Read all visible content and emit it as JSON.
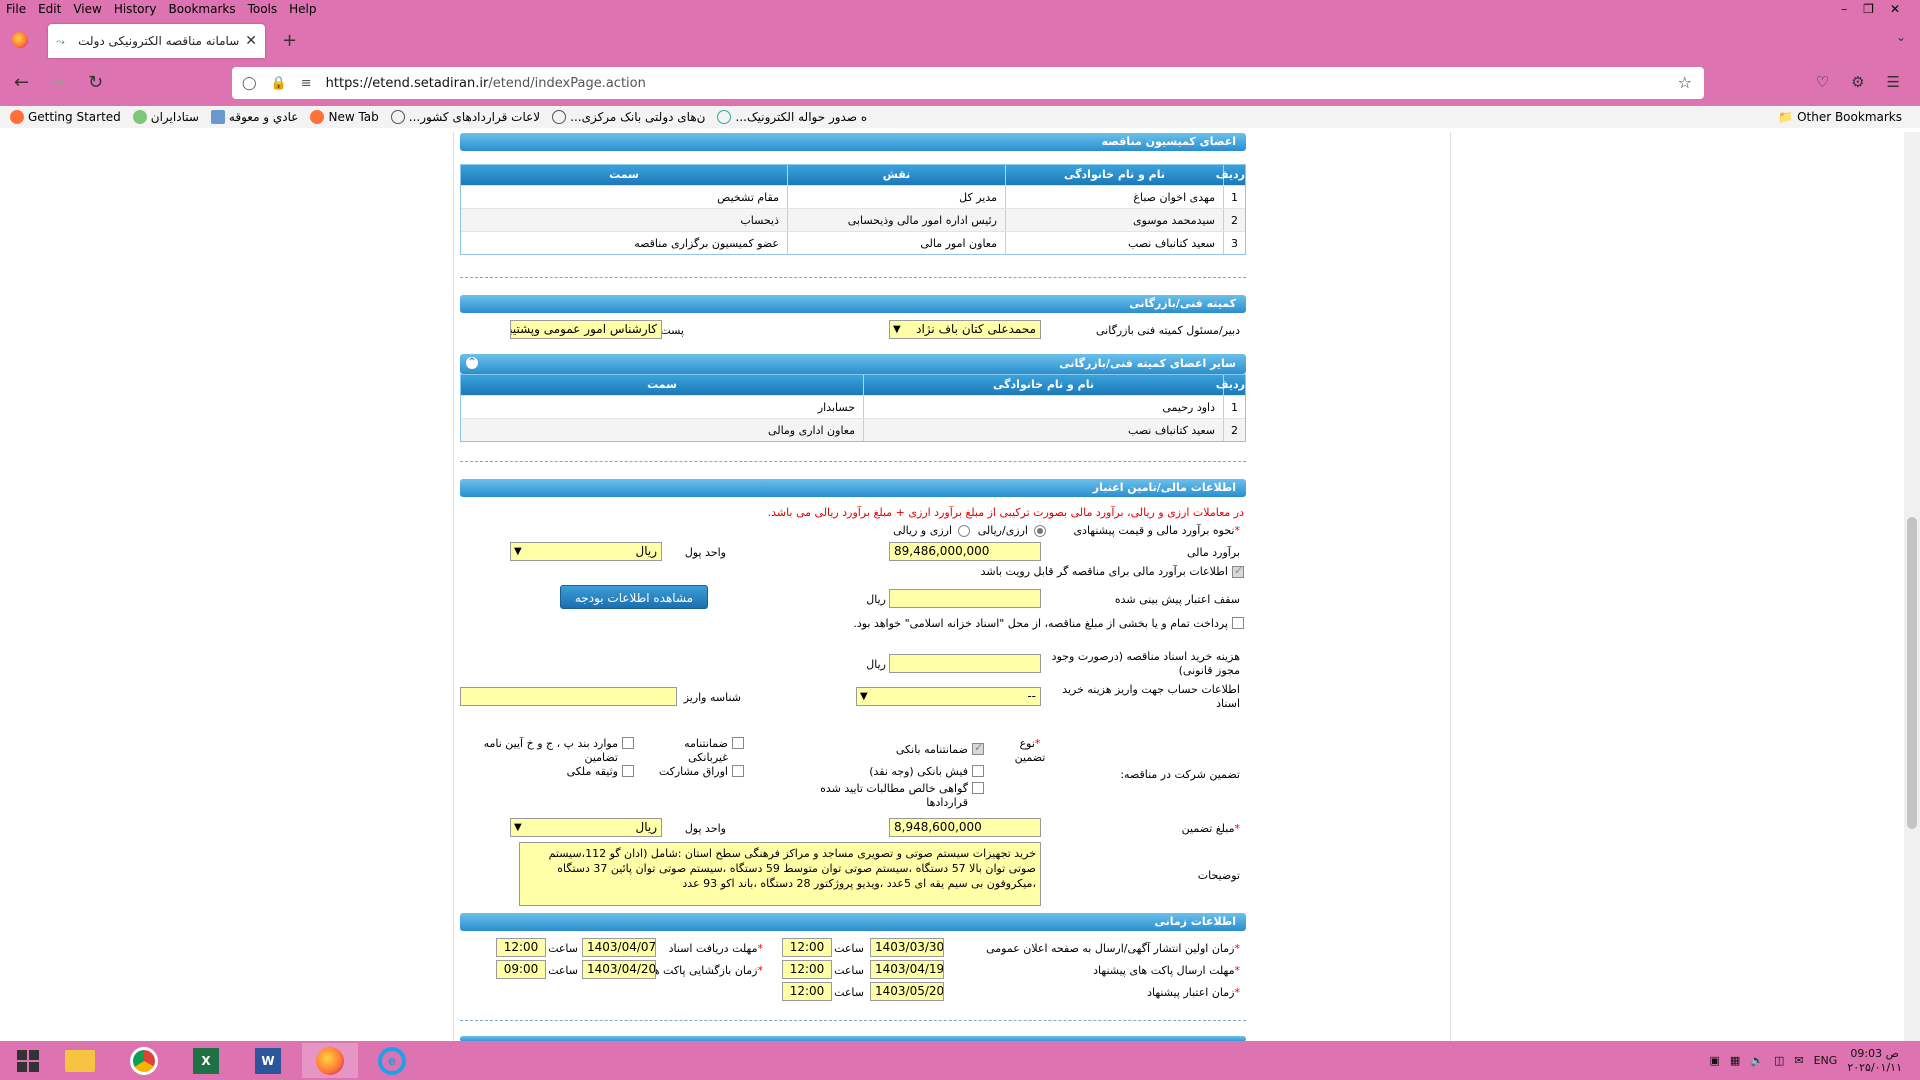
{
  "browser": {
    "menu": [
      "File",
      "Edit",
      "View",
      "History",
      "Bookmarks",
      "Tools",
      "Help"
    ],
    "tab_title": "سامانه مناقصه الکترونیکی دولت",
    "url_host": "https://etend.setadiran.ir",
    "url_path": "/etend/indexPage.action",
    "bookmarks": [
      "Getting Started",
      "ستادایران",
      "عادي و معوقه",
      "New Tab",
      "...لاعات قراردادهای کشور",
      "...ن‌های دولتی بانک مرکزی",
      "...ه صدور حواله الکترونیک"
    ],
    "other_bookmarks": "Other Bookmarks"
  },
  "commission": {
    "header": "اعضای کمیسیون مناقصه",
    "columns": {
      "idx": "ردیف",
      "name": "نام و نام خانوادگی",
      "role": "نقش",
      "position": "سمت"
    },
    "rows": [
      {
        "idx": "1",
        "name": "مهدی اخوان صباغ",
        "role": "مدیر کل",
        "position": "مقام تشخیص"
      },
      {
        "idx": "2",
        "name": "سیدمحمد موسوی",
        "role": "رئیس اداره امور مالی وذیحسابی",
        "position": "ذیحساب"
      },
      {
        "idx": "3",
        "name": "سعید کتانباف نصب",
        "role": "معاون امور مالی",
        "position": "عضو کمیسیون برگزاری مناقصه"
      }
    ]
  },
  "tech": {
    "header": "کمیته فنی/بازرگانی",
    "secretary_label": "دبیر/مسئول کمیته فنی بازرگانی",
    "secretary_value": "محمدعلی کتان باف نژاد",
    "post_label": "پست",
    "post_value": "کارشناس امور عمومی وپشتیبانی",
    "others_header": "سایر اعضای کمیته فنی/بازرگانی",
    "columns": {
      "idx": "ردیف",
      "name": "نام و نام خانوادگی",
      "position": "سمت"
    },
    "rows": [
      {
        "idx": "1",
        "name": "داود رحیمی",
        "position": "حسابدار"
      },
      {
        "idx": "2",
        "name": "سعید کتانباف نصب",
        "position": "معاون اداری ومالی"
      }
    ]
  },
  "finance": {
    "header": "اطلاعات مالی/تامین اعتبار",
    "note": "در معاملات ارزی و ریالی، برآورد مالی بصورت ترکیبی از مبلغ برآورد ارزی + مبلغ برآورد ریالی می باشد.",
    "estimate_method_label": "نحوه برآورد مالی و قیمت پیشنهادی",
    "radio_rial": "ارزی/ریالی",
    "radio_fx_rial": "ارزی و ریالی",
    "estimate_label": "برآورد مالی",
    "estimate_value": "89,486,000,000",
    "currency_label": "واحد پول",
    "currency_value": "ریال",
    "estimate_visible_label": "اطلاعات برآورد مالی برای مناقصه گر قابل رویت باشد",
    "credit_ceiling_label": "سقف اعتبار پیش بینی شده",
    "rial": "ریال",
    "budget_button": "مشاهده اطلاعات بودجه",
    "islamic_treasury_label": "پرداخت تمام و یا بخشی از مبلغ مناقصه، از محل \"اسناد خزانه اسلامی\" خواهد بود.",
    "doc_cost_label": "هزینه خرید اسناد مناقصه (درصورت وجود مجوز قانونی)",
    "account_label": "اطلاعات حساب جهت واریز هزینه خرید اسناد",
    "account_value": "--",
    "deposit_id_label": "شناسه واریز",
    "guarantee_label": "تضمین شرکت در مناقصه:",
    "guarantee_type_label": "نوع تضمین",
    "g_bank": "ضمانتنامه بانکی",
    "g_nonbank": "ضمانتنامه غیربانکی",
    "g_clauses": "موارد بند پ ، ج و خ آیین نامه تضامین",
    "g_cash": "فیش بانکی (وجه نقد)",
    "g_bonds": "اوراق مشارکت",
    "g_property": "وثیقه ملکی",
    "g_claims": "گواهی خالص مطالبات تایید شده قراردادها",
    "guarantee_amount_label": "مبلغ تضمین",
    "guarantee_amount_value": "8,948,600,000",
    "description_label": "توضیحات",
    "description_value": "خرید تجهیزات سیستم صوتی و تصویری مساجد و مراکز فرهنگی سطح استان :شامل (ادان گو 112،سیستم صوتی  توان بالا 57 دستگاه ،سیستم صوتی توان متوسط 59 دستگاه  ،سیستم صوتی توان پائین 37 دستگاه ،میکروفون بی سیم یقه ای 5عدد ،ویدیو پروژکتور 28  دستگاه ،باند اکو 93 عدد"
  },
  "timing": {
    "header": "اطلاعات زمانی",
    "hour": "ساعت",
    "first_pub_label": "زمان اولین انتشار آگهی/ارسال به صفحه اعلان عمومی",
    "first_pub_date": "1403/03/30",
    "first_pub_time": "12:00",
    "doc_receive_label": "مهلت دریافت اسناد",
    "doc_receive_date": "1403/04/07",
    "doc_receive_time": "12:00",
    "submit_label": "مهلت ارسال پاکت های پیشنهاد",
    "submit_date": "1403/04/19",
    "submit_time": "12:00",
    "open_label": "زمان بازگشایی پاکت ها",
    "open_date": "1403/04/20",
    "open_time": "09:00",
    "validity_label": "زمان اعتبار پیشنهاد",
    "validity_date": "1403/05/20",
    "validity_time": "12:00"
  },
  "taskbar": {
    "lang": "ENG",
    "time": "09:03 ص",
    "date": "۲۰۲۵/۰۱/۱۱"
  }
}
